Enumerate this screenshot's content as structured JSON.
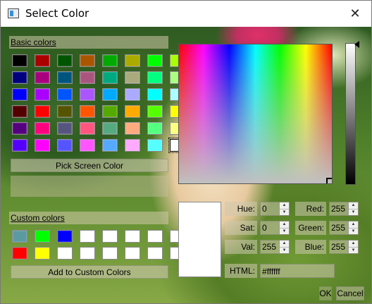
{
  "window": {
    "title": "Select Color",
    "close_glyph": "✕"
  },
  "basic_colors": {
    "label": "Basic colors",
    "rows": [
      [
        "#000000",
        "#aa0000",
        "#005500",
        "#aa5500",
        "#00aa00",
        "#aaaa00",
        "#00ff00",
        "#aaff00"
      ],
      [
        "#00007f",
        "#aa007f",
        "#00557f",
        "#aa557f",
        "#00aa7f",
        "#aaaa7f",
        "#00ff7f",
        "#aaff7f"
      ],
      [
        "#0000ff",
        "#aa00ff",
        "#0055ff",
        "#aa55ff",
        "#00aaff",
        "#aaaaff",
        "#00ffff",
        "#aaffff"
      ],
      [
        "#550000",
        "#ff0000",
        "#555500",
        "#ff5500",
        "#55aa00",
        "#ffaa00",
        "#55ff00",
        "#ffff00"
      ],
      [
        "#55007f",
        "#ff007f",
        "#55557f",
        "#ff557f",
        "#55aa7f",
        "#ffaa7f",
        "#55ff7f",
        "#ffff7f"
      ],
      [
        "#5500ff",
        "#ff00ff",
        "#5555ff",
        "#ff55ff",
        "#55aaff",
        "#ffaaff",
        "#55ffff",
        "#ffffff"
      ]
    ],
    "selected": "#ffffff"
  },
  "pick_screen_button": "Pick Screen Color",
  "custom_colors": {
    "label": "Custom colors",
    "rows": [
      [
        "#5b9aa0",
        "#00ff00",
        "#0000ff",
        "#ffffff",
        "#ffffff",
        "#ffffff",
        "#ffffff",
        "#ffffff"
      ],
      [
        "#ff0000",
        "#ffff00",
        "#ffffff",
        "#ffffff",
        "#ffffff",
        "#ffffff",
        "#ffffff",
        "#ffffff"
      ]
    ]
  },
  "add_custom_button": "Add to Custom Colors",
  "current_color": "#ffffff",
  "fields": {
    "hue": {
      "label": "Hue:",
      "value": "0"
    },
    "sat": {
      "label": "Sat:",
      "value": "0"
    },
    "val": {
      "label": "Val:",
      "value": "255"
    },
    "red": {
      "label": "Red:",
      "value": "255"
    },
    "green": {
      "label": "Green:",
      "value": "255"
    },
    "blue": {
      "label": "Blue:",
      "value": "255"
    },
    "html": {
      "label": "HTML:",
      "value": "#ffffff"
    }
  },
  "buttons": {
    "ok": "OK",
    "cancel": "Cancel"
  },
  "spin_up_glyph": "▲",
  "spin_down_glyph": "▼"
}
